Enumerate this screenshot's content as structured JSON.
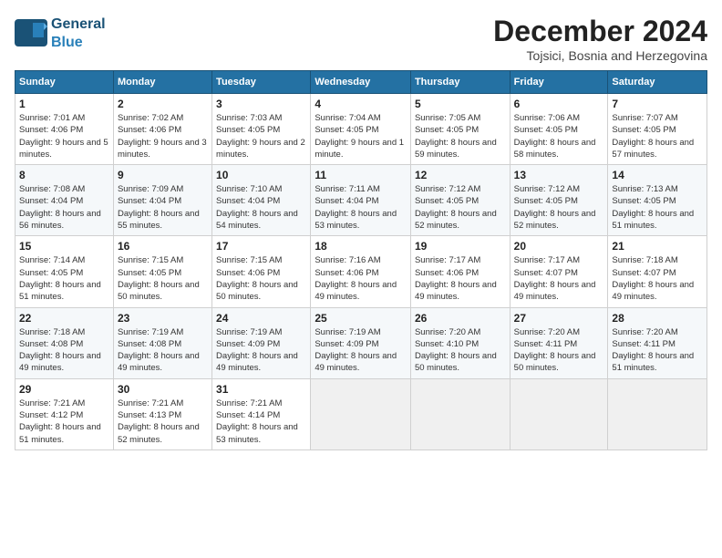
{
  "header": {
    "logo_line1": "General",
    "logo_line2": "Blue",
    "month_year": "December 2024",
    "location": "Tojsici, Bosnia and Herzegovina"
  },
  "weekdays": [
    "Sunday",
    "Monday",
    "Tuesday",
    "Wednesday",
    "Thursday",
    "Friday",
    "Saturday"
  ],
  "weeks": [
    [
      {
        "day": "1",
        "info": "Sunrise: 7:01 AM\nSunset: 4:06 PM\nDaylight: 9 hours and 5 minutes."
      },
      {
        "day": "2",
        "info": "Sunrise: 7:02 AM\nSunset: 4:06 PM\nDaylight: 9 hours and 3 minutes."
      },
      {
        "day": "3",
        "info": "Sunrise: 7:03 AM\nSunset: 4:05 PM\nDaylight: 9 hours and 2 minutes."
      },
      {
        "day": "4",
        "info": "Sunrise: 7:04 AM\nSunset: 4:05 PM\nDaylight: 9 hours and 1 minute."
      },
      {
        "day": "5",
        "info": "Sunrise: 7:05 AM\nSunset: 4:05 PM\nDaylight: 8 hours and 59 minutes."
      },
      {
        "day": "6",
        "info": "Sunrise: 7:06 AM\nSunset: 4:05 PM\nDaylight: 8 hours and 58 minutes."
      },
      {
        "day": "7",
        "info": "Sunrise: 7:07 AM\nSunset: 4:05 PM\nDaylight: 8 hours and 57 minutes."
      }
    ],
    [
      {
        "day": "8",
        "info": "Sunrise: 7:08 AM\nSunset: 4:04 PM\nDaylight: 8 hours and 56 minutes."
      },
      {
        "day": "9",
        "info": "Sunrise: 7:09 AM\nSunset: 4:04 PM\nDaylight: 8 hours and 55 minutes."
      },
      {
        "day": "10",
        "info": "Sunrise: 7:10 AM\nSunset: 4:04 PM\nDaylight: 8 hours and 54 minutes."
      },
      {
        "day": "11",
        "info": "Sunrise: 7:11 AM\nSunset: 4:04 PM\nDaylight: 8 hours and 53 minutes."
      },
      {
        "day": "12",
        "info": "Sunrise: 7:12 AM\nSunset: 4:05 PM\nDaylight: 8 hours and 52 minutes."
      },
      {
        "day": "13",
        "info": "Sunrise: 7:12 AM\nSunset: 4:05 PM\nDaylight: 8 hours and 52 minutes."
      },
      {
        "day": "14",
        "info": "Sunrise: 7:13 AM\nSunset: 4:05 PM\nDaylight: 8 hours and 51 minutes."
      }
    ],
    [
      {
        "day": "15",
        "info": "Sunrise: 7:14 AM\nSunset: 4:05 PM\nDaylight: 8 hours and 51 minutes."
      },
      {
        "day": "16",
        "info": "Sunrise: 7:15 AM\nSunset: 4:05 PM\nDaylight: 8 hours and 50 minutes."
      },
      {
        "day": "17",
        "info": "Sunrise: 7:15 AM\nSunset: 4:06 PM\nDaylight: 8 hours and 50 minutes."
      },
      {
        "day": "18",
        "info": "Sunrise: 7:16 AM\nSunset: 4:06 PM\nDaylight: 8 hours and 49 minutes."
      },
      {
        "day": "19",
        "info": "Sunrise: 7:17 AM\nSunset: 4:06 PM\nDaylight: 8 hours and 49 minutes."
      },
      {
        "day": "20",
        "info": "Sunrise: 7:17 AM\nSunset: 4:07 PM\nDaylight: 8 hours and 49 minutes."
      },
      {
        "day": "21",
        "info": "Sunrise: 7:18 AM\nSunset: 4:07 PM\nDaylight: 8 hours and 49 minutes."
      }
    ],
    [
      {
        "day": "22",
        "info": "Sunrise: 7:18 AM\nSunset: 4:08 PM\nDaylight: 8 hours and 49 minutes."
      },
      {
        "day": "23",
        "info": "Sunrise: 7:19 AM\nSunset: 4:08 PM\nDaylight: 8 hours and 49 minutes."
      },
      {
        "day": "24",
        "info": "Sunrise: 7:19 AM\nSunset: 4:09 PM\nDaylight: 8 hours and 49 minutes."
      },
      {
        "day": "25",
        "info": "Sunrise: 7:19 AM\nSunset: 4:09 PM\nDaylight: 8 hours and 49 minutes."
      },
      {
        "day": "26",
        "info": "Sunrise: 7:20 AM\nSunset: 4:10 PM\nDaylight: 8 hours and 50 minutes."
      },
      {
        "day": "27",
        "info": "Sunrise: 7:20 AM\nSunset: 4:11 PM\nDaylight: 8 hours and 50 minutes."
      },
      {
        "day": "28",
        "info": "Sunrise: 7:20 AM\nSunset: 4:11 PM\nDaylight: 8 hours and 51 minutes."
      }
    ],
    [
      {
        "day": "29",
        "info": "Sunrise: 7:21 AM\nSunset: 4:12 PM\nDaylight: 8 hours and 51 minutes."
      },
      {
        "day": "30",
        "info": "Sunrise: 7:21 AM\nSunset: 4:13 PM\nDaylight: 8 hours and 52 minutes."
      },
      {
        "day": "31",
        "info": "Sunrise: 7:21 AM\nSunset: 4:14 PM\nDaylight: 8 hours and 53 minutes."
      },
      {
        "day": "",
        "info": ""
      },
      {
        "day": "",
        "info": ""
      },
      {
        "day": "",
        "info": ""
      },
      {
        "day": "",
        "info": ""
      }
    ]
  ]
}
